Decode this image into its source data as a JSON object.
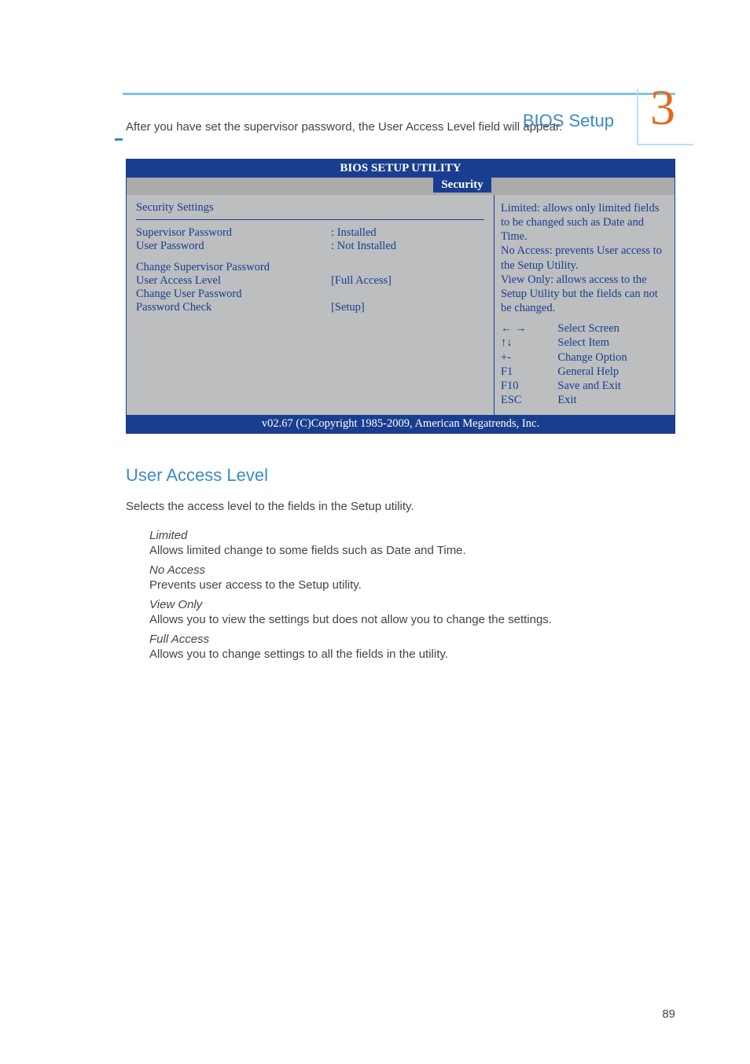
{
  "header": {
    "chapter_title": "BIOS Setup",
    "chapter_number": "3"
  },
  "intro": "After you have set the supervisor password, the User Access Level field will appear.",
  "bios": {
    "title": "BIOS SETUP UTILITY",
    "tab": "Security",
    "panel_heading": "Security Settings",
    "rows": {
      "supervisor_pw_label": "Supervisor Password",
      "supervisor_pw_value": ":  Installed",
      "user_pw_label": "User Password",
      "user_pw_value": ":  Not Installed",
      "change_sup_pw": "Change Supervisor Password",
      "user_access_level_label": "User Access Level",
      "user_access_level_value": "[Full Access]",
      "change_user_pw": "Change User Password",
      "password_check_label": "Password Check",
      "password_check_value": "[Setup]"
    },
    "help_text": "Limited: allows only limited fields to be changed such as Date and Time.\nNo Access: prevents User access to the Setup Utility.\nView Only: allows access to the Setup Utility but the fields can not be changed.",
    "keys": [
      {
        "k": "← →",
        "a": "Select Screen"
      },
      {
        "k": "↑↓",
        "a": "Select Item"
      },
      {
        "k": "+-",
        "a": "Change Option"
      },
      {
        "k": "F1",
        "a": "General Help"
      },
      {
        "k": "F10",
        "a": "Save and Exit"
      },
      {
        "k": "ESC",
        "a": "Exit"
      }
    ],
    "footer": "v02.67 (C)Copyright 1985-2009, American Megatrends, Inc."
  },
  "section": {
    "heading": "User Access Level",
    "description": "Selects the access level to the fields in the Setup utility.",
    "options": {
      "limited_name": "Limited",
      "limited_desc": "Allows limited change to some fields such as Date and Time.",
      "noaccess_name": "No Access",
      "noaccess_desc": "Prevents user access to the Setup utility.",
      "viewonly_name": "View Only",
      "viewonly_desc": "Allows you to view the settings but does not allow you to change the settings.",
      "fullaccess_name": "Full Access",
      "fullaccess_desc": "Allows you to change settings to all the fields in the utility."
    }
  },
  "page_number": "89"
}
